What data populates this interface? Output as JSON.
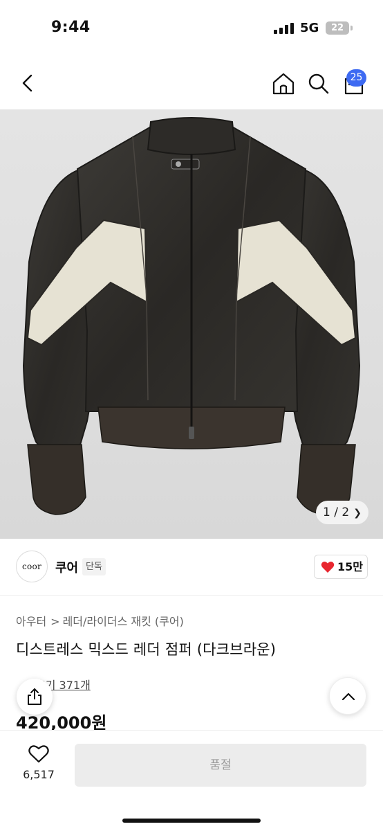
{
  "status_bar": {
    "time": "9:44",
    "network": "5G",
    "battery": "22"
  },
  "nav": {
    "icons": [
      "back-arrow-icon",
      "home-icon",
      "search-icon",
      "cart-icon"
    ],
    "cart_badge": "25"
  },
  "product_image": {
    "counter": "1 / 2"
  },
  "brand": {
    "logo_text": "coor",
    "name": "쿠어",
    "tag": "단독",
    "likes": "15만",
    "heart_color": "#e8262f"
  },
  "product": {
    "breadcrumb": [
      "아우터",
      "레더/라이더스 재킷 (쿠어)"
    ],
    "breadcrumb_sep": ">",
    "title": "디스트레스 믹스드 레더 점퍼 (다크브라운)",
    "review_text": "후기 371개",
    "price": "420,000원"
  },
  "bottom_bar": {
    "wish_count": "6,517",
    "buy_button": "품절"
  },
  "colors": {
    "accent": "#3d6af2",
    "like": "#e8262f"
  }
}
